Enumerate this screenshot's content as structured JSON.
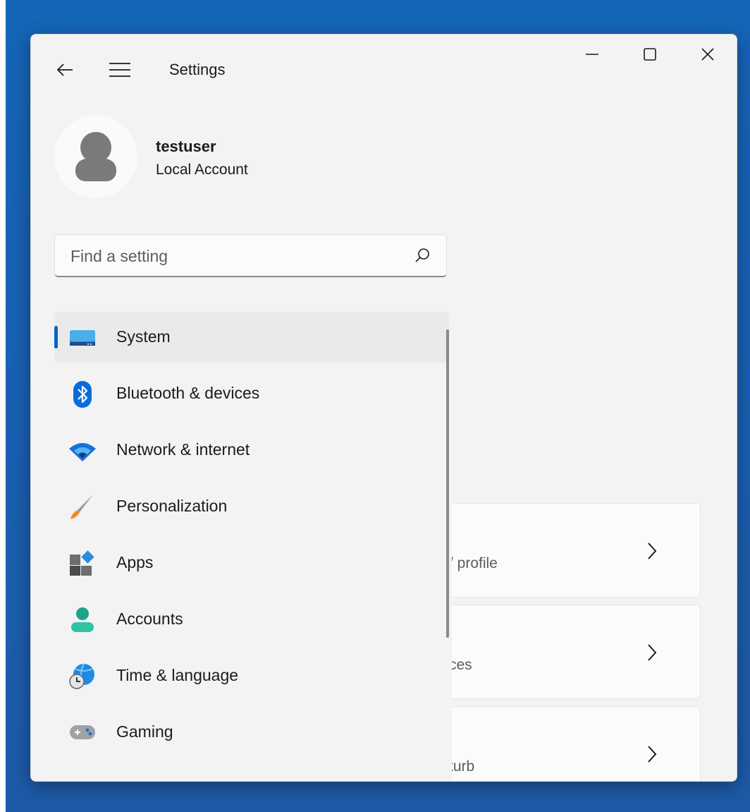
{
  "window": {
    "title": "Settings"
  },
  "profile": {
    "name": "testuser",
    "account_type": "Local Account"
  },
  "search": {
    "placeholder": "Find a setting"
  },
  "nav": {
    "items": [
      {
        "label": "System",
        "icon": "system-display-icon",
        "selected": true
      },
      {
        "label": "Bluetooth & devices",
        "icon": "bluetooth-icon"
      },
      {
        "label": "Network & internet",
        "icon": "wifi-icon"
      },
      {
        "label": "Personalization",
        "icon": "paintbrush-icon"
      },
      {
        "label": "Apps",
        "icon": "apps-icon"
      },
      {
        "label": "Accounts",
        "icon": "accounts-person-icon"
      },
      {
        "label": "Time & language",
        "icon": "globe-clock-icon"
      },
      {
        "label": "Gaming",
        "icon": "gamepad-icon"
      }
    ]
  },
  "content": {
    "cards": [
      {
        "subtitle_fragment": "/ profile"
      },
      {
        "subtitle_fragment": "ces"
      },
      {
        "subtitle_fragment": "turb"
      }
    ]
  },
  "colors": {
    "accent": "#0067c0",
    "window_bg": "#f3f3f3",
    "desktop": "#1565b8"
  }
}
